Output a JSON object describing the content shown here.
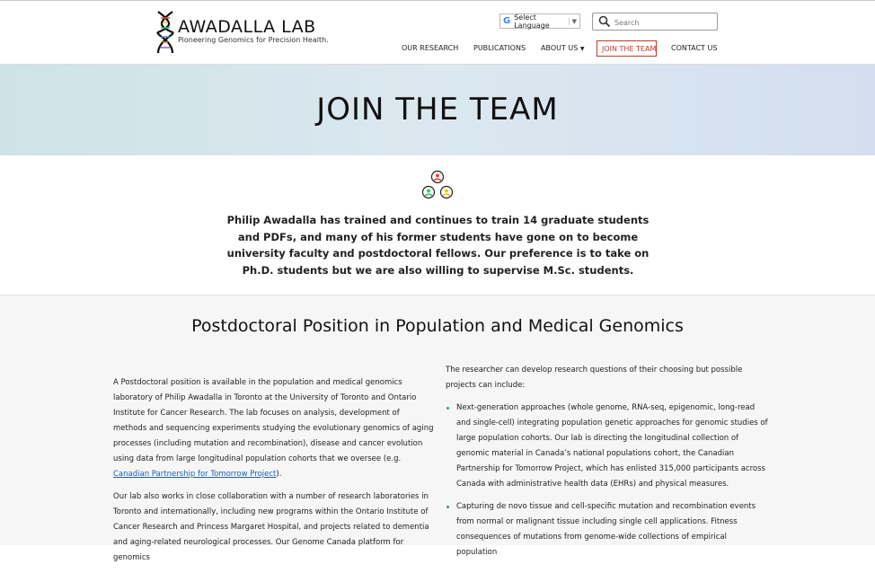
{
  "header": {
    "logo_title": "AWADALLA LAB",
    "logo_tagline": "Pioneering Genomics for Precision Health.",
    "language_label": "Select Language",
    "search_placeholder": "Search",
    "nav": {
      "research": "OUR RESEARCH",
      "publications": "PUBLICATIONS",
      "about": "ABOUT US",
      "join": "JOIN THE TEAM",
      "contact": "CONTACT US"
    }
  },
  "hero": {
    "title": "JOIN THE TEAM"
  },
  "intro": "Philip Awadalla has trained and continues to train 14 graduate students and PDFs, and many of his former students have gone on to become university faculty and postdoctoral fellows. Our preference is to take on Ph.D. students but we are also willing to supervise M.Sc. students.",
  "section": {
    "title": "Postdoctoral Position in Population and Medical Genomics",
    "left_p1_a": "A Postdoctoral position is available in the population and medical genomics laboratory of Philip Awadalla in Toronto at the University of Toronto and Ontario Institute for Cancer Research. The lab focuses on analysis, development of methods and sequencing experiments studying the evolutionary genomics of aging processes (including mutation and recombination), disease and cancer evolution using data from large longitudinal population cohorts that we oversee (e.g. ",
    "left_p1_link": "Canadian Partnership for Tomorrow Project",
    "left_p1_b": ").",
    "left_p2": "Our lab also works in close collaboration with a number of research laboratories in Toronto and internationally, including new programs within the Ontario Institute of Cancer Research and Princess Margaret Hospital, and projects related to dementia and aging-related neurological processes. Our Genome Canada platform for genomics",
    "right_intro": "The researcher can develop research questions of their choosing but possible projects can include:",
    "bullets": [
      "Next-generation approaches (whole genome, RNA-seq, epigenomic, long-read and single-cell) integrating population genetic approaches for genomic studies of large population cohorts. Our lab is directing the longitudinal collection of genomic material in Canada’s national populations cohort, the Canadian Partnership for Tomorrow Project, which has enlisted 315,000 participants across Canada with administrative health data (EHRs) and physical measures.",
      "Capturing de novo tissue and cell-specific mutation and recombination events from normal or malignant tissue including single cell applications. Fitness consequences of mutations from genome-wide collections of empirical population"
    ]
  },
  "colors": {
    "accent": "#c0392b",
    "link": "#1a5fa6",
    "bullet": "#2e9e7a"
  }
}
